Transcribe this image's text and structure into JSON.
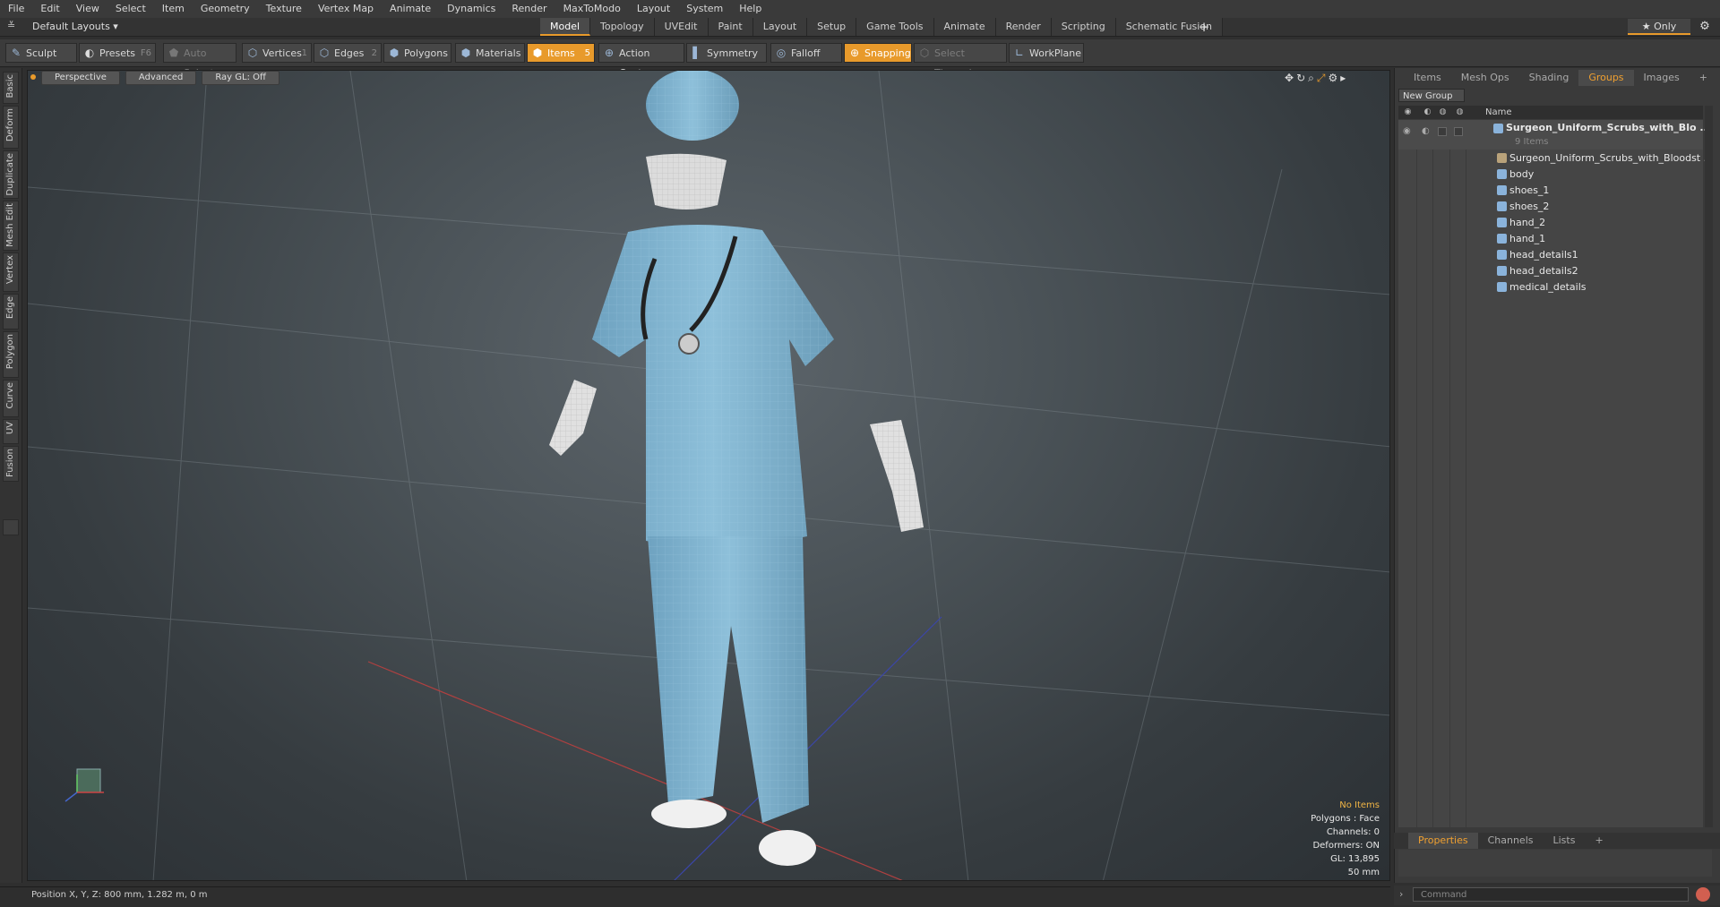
{
  "menu": [
    "File",
    "Edit",
    "View",
    "Select",
    "Item",
    "Geometry",
    "Texture",
    "Vertex Map",
    "Animate",
    "Dynamics",
    "Render",
    "MaxToModo",
    "Layout",
    "System",
    "Help"
  ],
  "layout_select": "Default Layouts ▾",
  "tabs": [
    "Model",
    "Topology",
    "UVEdit",
    "Paint",
    "Layout",
    "Setup",
    "Game Tools",
    "Animate",
    "Render",
    "Scripting",
    "Schematic Fusion"
  ],
  "active_tab": "Model",
  "tab_add": "+",
  "only_label": "★  Only",
  "toolbar": {
    "sculpt": "Sculpt",
    "presets": "Presets",
    "presets_key": "F6",
    "auto_select": "Auto Select",
    "vertices": "Vertices",
    "vertices_key": "1",
    "edges": "Edges",
    "edges_key": "2",
    "polygons": "Polygons",
    "materials": "Materials",
    "items": "Items",
    "items_key": "5",
    "action_center": "Action Center",
    "symmetry": "Symmetry",
    "falloff": "Falloff",
    "snapping": "Snapping",
    "select_through": "Select Through",
    "workplane": "WorkPlane"
  },
  "left_tabs": [
    "Basic",
    "Deform",
    "Duplicate",
    "Mesh Edit",
    "Vertex",
    "Edge",
    "Polygon",
    "Curve",
    "UV",
    "Fusion"
  ],
  "viewport": {
    "perspective": "Perspective",
    "advanced": "Advanced",
    "raygl": "Ray GL: Off",
    "stats": [
      "No Items",
      "Polygons : Face",
      "Channels: 0",
      "Deformers: ON",
      "GL: 13,895",
      "50 mm"
    ]
  },
  "right_tabs": [
    "Items",
    "Mesh Ops",
    "Shading",
    "Groups",
    "Images",
    "+"
  ],
  "active_right_tab": "Groups",
  "new_group": "New Group",
  "list_header_name": "Name",
  "group": {
    "name": "Surgeon_Uniform_Scrubs_with_Blo ...",
    "count": "9 Items",
    "children": [
      "Surgeon_Uniform_Scrubs_with_Bloodst ...",
      "body",
      "shoes_1",
      "shoes_2",
      "hand_2",
      "hand_1",
      "head_details1",
      "head_details2",
      "medical_details"
    ]
  },
  "prop_tabs": [
    "Properties",
    "Channels",
    "Lists",
    "+"
  ],
  "command_placeholder": "Command",
  "status": "Position X, Y, Z:  800 mm, 1.282 m, 0 m",
  "colors": {
    "accent": "#e89a2b",
    "scrubs": "#7fb0cc",
    "viewport_bg": "#4a5257"
  }
}
